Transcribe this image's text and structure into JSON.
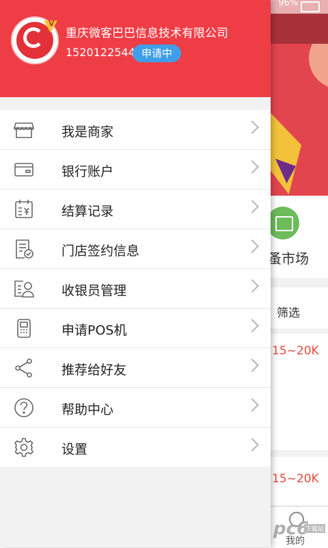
{
  "status_bar": {
    "battery_text": "96%"
  },
  "background": {
    "market_label": "蚤市场",
    "filter_label": "筛选",
    "salary_1": "15~20K",
    "salary_2": "15~20K",
    "tab_label": "我的",
    "watermark": "pc6",
    "watermark_sub": "下载站"
  },
  "drawer": {
    "company_name": "重庆微客巴巴信息技术有限公司",
    "phone": "1520122544",
    "apply_status": "申请中",
    "vip_label": "V",
    "menu_items": [
      {
        "label": "我是商家",
        "icon": "store-icon"
      },
      {
        "label": "银行账户",
        "icon": "bank-card-icon"
      },
      {
        "label": "结算记录",
        "icon": "settlement-calendar-icon"
      },
      {
        "label": "门店签约信息",
        "icon": "contract-document-icon"
      },
      {
        "label": "收银员管理",
        "icon": "cashier-id-icon"
      },
      {
        "label": "申请POS机",
        "icon": "pos-machine-icon"
      },
      {
        "label": "推荐给好友",
        "icon": "share-icon"
      },
      {
        "label": "帮助中心",
        "icon": "help-icon"
      },
      {
        "label": "设置",
        "icon": "settings-gear-icon"
      }
    ]
  },
  "colors": {
    "header_red": "#ef3d46",
    "badge_blue": "#3f9ee8",
    "icon_gray": "#666666"
  }
}
